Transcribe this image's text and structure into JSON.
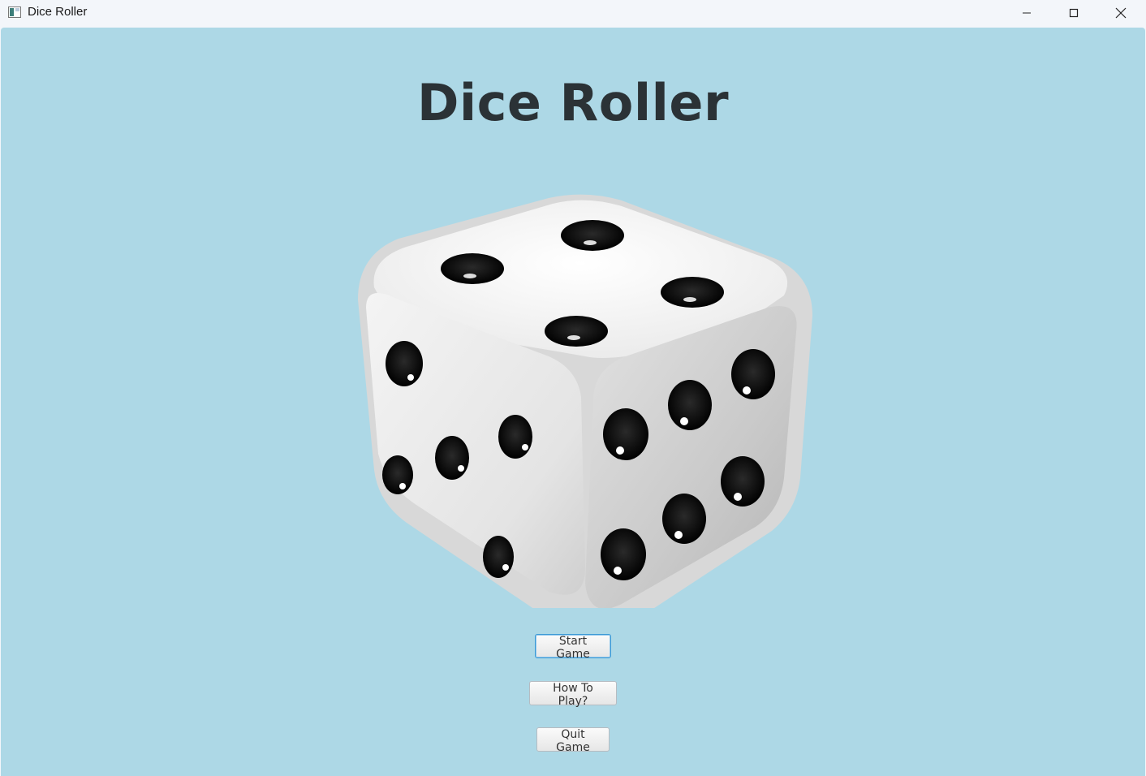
{
  "window": {
    "title": "Dice Roller"
  },
  "main": {
    "heading": "Dice Roller",
    "dice_image": "white-die-3d-icon"
  },
  "buttons": {
    "start": "Start Game",
    "how_to_play": "How To Play?",
    "quit": "Quit Game"
  },
  "colors": {
    "background": "#add8e6",
    "heading": "#2b3236",
    "focus_border": "#3c9ad6"
  }
}
